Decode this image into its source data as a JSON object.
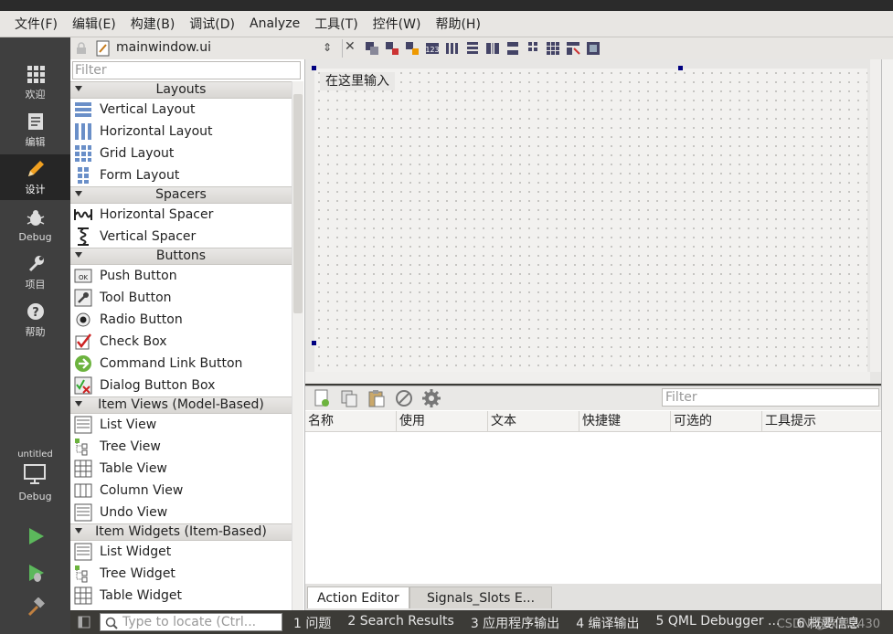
{
  "menubar": [
    "文件(F)",
    "编辑(E)",
    "构建(B)",
    "调试(D)",
    "Analyze",
    "工具(T)",
    "控件(W)",
    "帮助(H)"
  ],
  "modes": [
    {
      "label": "欢迎",
      "icon": "grid-icon"
    },
    {
      "label": "编辑",
      "icon": "document-icon"
    },
    {
      "label": "设计",
      "icon": "pencil-icon"
    },
    {
      "label": "Debug",
      "icon": "bug-icon"
    },
    {
      "label": "项目",
      "icon": "wrench-icon"
    },
    {
      "label": "帮助",
      "icon": "help-icon"
    }
  ],
  "kit": {
    "project": "untitled",
    "config": "Debug"
  },
  "file": {
    "title": "mainwindow.ui"
  },
  "widgetbox": {
    "filter_placeholder": "Filter",
    "categories": [
      {
        "name": "Layouts",
        "items": [
          "Vertical Layout",
          "Horizontal Layout",
          "Grid Layout",
          "Form Layout"
        ]
      },
      {
        "name": "Spacers",
        "items": [
          "Horizontal Spacer",
          "Vertical Spacer"
        ]
      },
      {
        "name": "Buttons",
        "items": [
          "Push Button",
          "Tool Button",
          "Radio Button",
          "Check Box",
          "Command Link Button",
          "Dialog Button Box"
        ]
      },
      {
        "name": "Item Views (Model-Based)",
        "items": [
          "List View",
          "Tree View",
          "Table View",
          "Column View",
          "Undo View"
        ]
      },
      {
        "name": "Item Widgets (Item-Based)",
        "items": [
          "List Widget",
          "Tree Widget",
          "Table Widget"
        ]
      }
    ]
  },
  "form": {
    "menu_placeholder": "在这里输入"
  },
  "action_editor": {
    "filter_placeholder": "Filter",
    "columns": [
      "名称",
      "使用",
      "文本",
      "快捷键",
      "可选的",
      "工具提示"
    ],
    "tabs": [
      "Action Editor",
      "Signals_Slots E..."
    ]
  },
  "statusbar": {
    "locator_placeholder": "Type to locate (Ctrl...",
    "outputs": [
      "1 问题",
      "2 Search Results",
      "3 应用程序输出",
      "4 编译输出",
      "5 QML Debugger ...",
      "6 概要信息"
    ],
    "watermark": "CSDN @坎思2430"
  }
}
